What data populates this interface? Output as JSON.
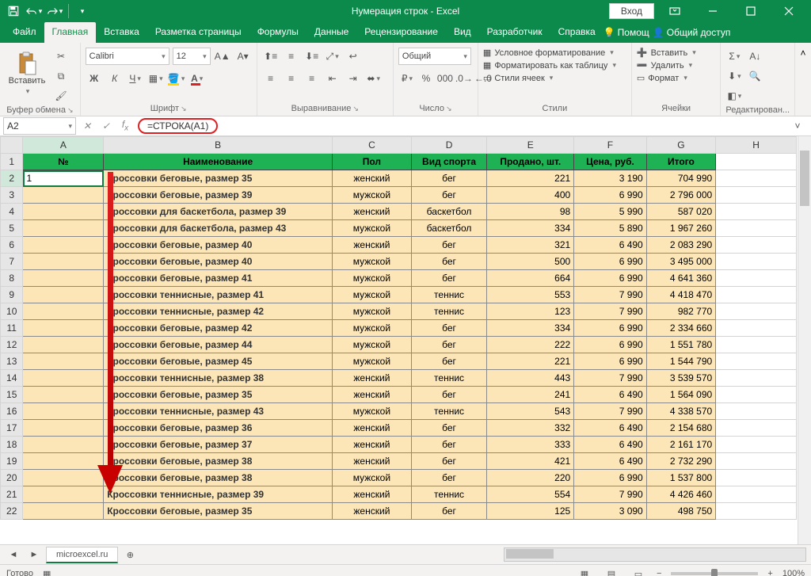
{
  "titlebar": {
    "title": "Нумерация строк  -  Excel",
    "signin": "Вход"
  },
  "tabs": {
    "file": "Файл",
    "home": "Главная",
    "insert": "Вставка",
    "pagelayout": "Разметка страницы",
    "formulas": "Формулы",
    "data": "Данные",
    "review": "Рецензирование",
    "view": "Вид",
    "developer": "Разработчик",
    "help": "Справка",
    "tellme": "Помощ",
    "share": "Общий доступ"
  },
  "ribbon": {
    "clipboard": {
      "label": "Буфер обмена",
      "paste": "Вставить"
    },
    "font": {
      "label": "Шрифт",
      "name": "Calibri",
      "size": "12"
    },
    "align": {
      "label": "Выравнивание"
    },
    "number": {
      "label": "Число",
      "format": "Общий"
    },
    "styles": {
      "label": "Стили",
      "cond": "Условное форматирование",
      "table": "Форматировать как таблицу",
      "cell": "Стили ячеек"
    },
    "cells": {
      "label": "Ячейки",
      "insert": "Вставить",
      "delete": "Удалить",
      "format": "Формат"
    },
    "editing": {
      "label": "Редактирован..."
    }
  },
  "fx": {
    "cellref": "A2",
    "formula": "=СТРОКА(A1)"
  },
  "columns": [
    "A",
    "B",
    "C",
    "D",
    "E",
    "F",
    "G",
    "H"
  ],
  "header_row": [
    "№",
    "Наименование",
    "Пол",
    "Вид спорта",
    "Продано, шт.",
    "Цена, руб.",
    "Итого",
    ""
  ],
  "rows": [
    {
      "n": "1",
      "name": "Кроссовки беговые, размер 35",
      "sex": "женский",
      "sport": "бег",
      "sold": "221",
      "price": "3 190",
      "total": "704 990"
    },
    {
      "n": "",
      "name": "Кроссовки беговые, размер 39",
      "sex": "мужской",
      "sport": "бег",
      "sold": "400",
      "price": "6 990",
      "total": "2 796 000"
    },
    {
      "n": "",
      "name": "Кроссовки для баскетбола, размер 39",
      "sex": "женский",
      "sport": "баскетбол",
      "sold": "98",
      "price": "5 990",
      "total": "587 020"
    },
    {
      "n": "",
      "name": "Кроссовки для баскетбола, размер 43",
      "sex": "мужской",
      "sport": "баскетбол",
      "sold": "334",
      "price": "5 890",
      "total": "1 967 260"
    },
    {
      "n": "",
      "name": "Кроссовки беговые, размер 40",
      "sex": "женский",
      "sport": "бег",
      "sold": "321",
      "price": "6 490",
      "total": "2 083 290"
    },
    {
      "n": "",
      "name": "Кроссовки беговые, размер 40",
      "sex": "мужской",
      "sport": "бег",
      "sold": "500",
      "price": "6 990",
      "total": "3 495 000"
    },
    {
      "n": "",
      "name": "Кроссовки беговые, размер 41",
      "sex": "мужской",
      "sport": "бег",
      "sold": "664",
      "price": "6 990",
      "total": "4 641 360"
    },
    {
      "n": "",
      "name": "Кроссовки теннисные, размер 41",
      "sex": "мужской",
      "sport": "теннис",
      "sold": "553",
      "price": "7 990",
      "total": "4 418 470"
    },
    {
      "n": "",
      "name": "Кроссовки теннисные, размер 42",
      "sex": "мужской",
      "sport": "теннис",
      "sold": "123",
      "price": "7 990",
      "total": "982 770"
    },
    {
      "n": "",
      "name": "Кроссовки беговые, размер 42",
      "sex": "мужской",
      "sport": "бег",
      "sold": "334",
      "price": "6 990",
      "total": "2 334 660"
    },
    {
      "n": "",
      "name": "Кроссовки беговые, размер 44",
      "sex": "мужской",
      "sport": "бег",
      "sold": "222",
      "price": "6 990",
      "total": "1 551 780"
    },
    {
      "n": "",
      "name": "Кроссовки беговые, размер 45",
      "sex": "мужской",
      "sport": "бег",
      "sold": "221",
      "price": "6 990",
      "total": "1 544 790"
    },
    {
      "n": "",
      "name": "Кроссовки теннисные, размер 38",
      "sex": "женский",
      "sport": "теннис",
      "sold": "443",
      "price": "7 990",
      "total": "3 539 570"
    },
    {
      "n": "",
      "name": "Кроссовки беговые, размер 35",
      "sex": "женский",
      "sport": "бег",
      "sold": "241",
      "price": "6 490",
      "total": "1 564 090"
    },
    {
      "n": "",
      "name": "Кроссовки теннисные, размер 43",
      "sex": "мужской",
      "sport": "теннис",
      "sold": "543",
      "price": "7 990",
      "total": "4 338 570"
    },
    {
      "n": "",
      "name": "Кроссовки беговые, размер 36",
      "sex": "женский",
      "sport": "бег",
      "sold": "332",
      "price": "6 490",
      "total": "2 154 680"
    },
    {
      "n": "",
      "name": "Кроссовки беговые, размер 37",
      "sex": "женский",
      "sport": "бег",
      "sold": "333",
      "price": "6 490",
      "total": "2 161 170"
    },
    {
      "n": "",
      "name": "Кроссовки беговые, размер 38",
      "sex": "женский",
      "sport": "бег",
      "sold": "421",
      "price": "6 490",
      "total": "2 732 290"
    },
    {
      "n": "",
      "name": "Кроссовки беговые, размер 38",
      "sex": "мужской",
      "sport": "бег",
      "sold": "220",
      "price": "6 990",
      "total": "1 537 800"
    },
    {
      "n": "",
      "name": "Кроссовки теннисные, размер 39",
      "sex": "женский",
      "sport": "теннис",
      "sold": "554",
      "price": "7 990",
      "total": "4 426 460"
    },
    {
      "n": "",
      "name": "Кроссовки беговые, размер 35",
      "sex": "женский",
      "sport": "бег",
      "sold": "125",
      "price": "3 090",
      "total": "498 750"
    }
  ],
  "sheets": {
    "tab1": "microexcel.ru"
  },
  "status": {
    "ready": "Готово",
    "zoom": "100%"
  }
}
